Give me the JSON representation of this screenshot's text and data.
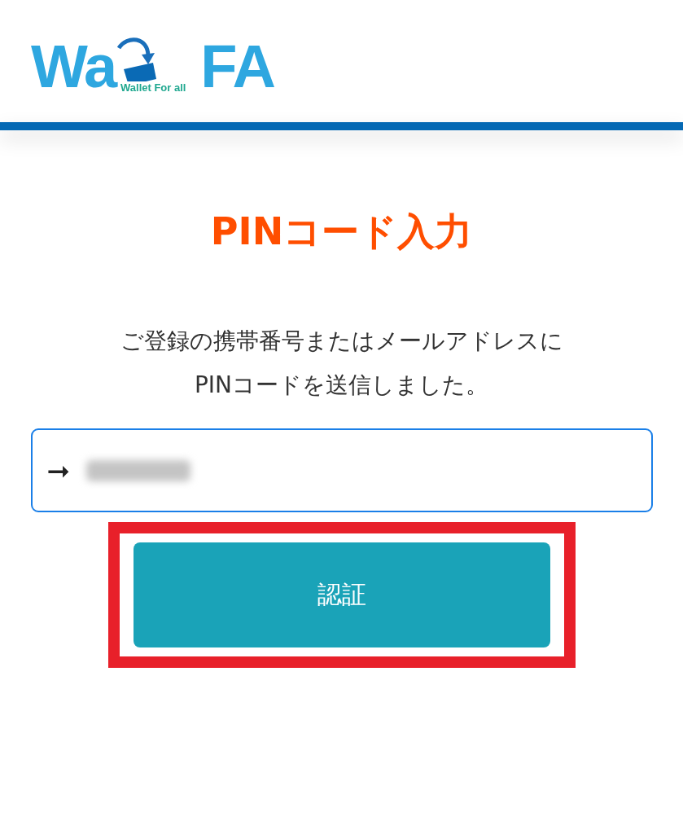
{
  "header": {
    "logo": {
      "left": "Wa",
      "right": "FA",
      "tagline": "Wallet For all"
    }
  },
  "title": "PINコード入力",
  "message": [
    "ご登録の携帯番号またはメールアドレスに",
    "PINコードを送信しました。"
  ],
  "pin_field": {
    "prefix": "➞",
    "value_redacted": true
  },
  "submit_button": {
    "label": "認証",
    "highlighted": true
  }
}
